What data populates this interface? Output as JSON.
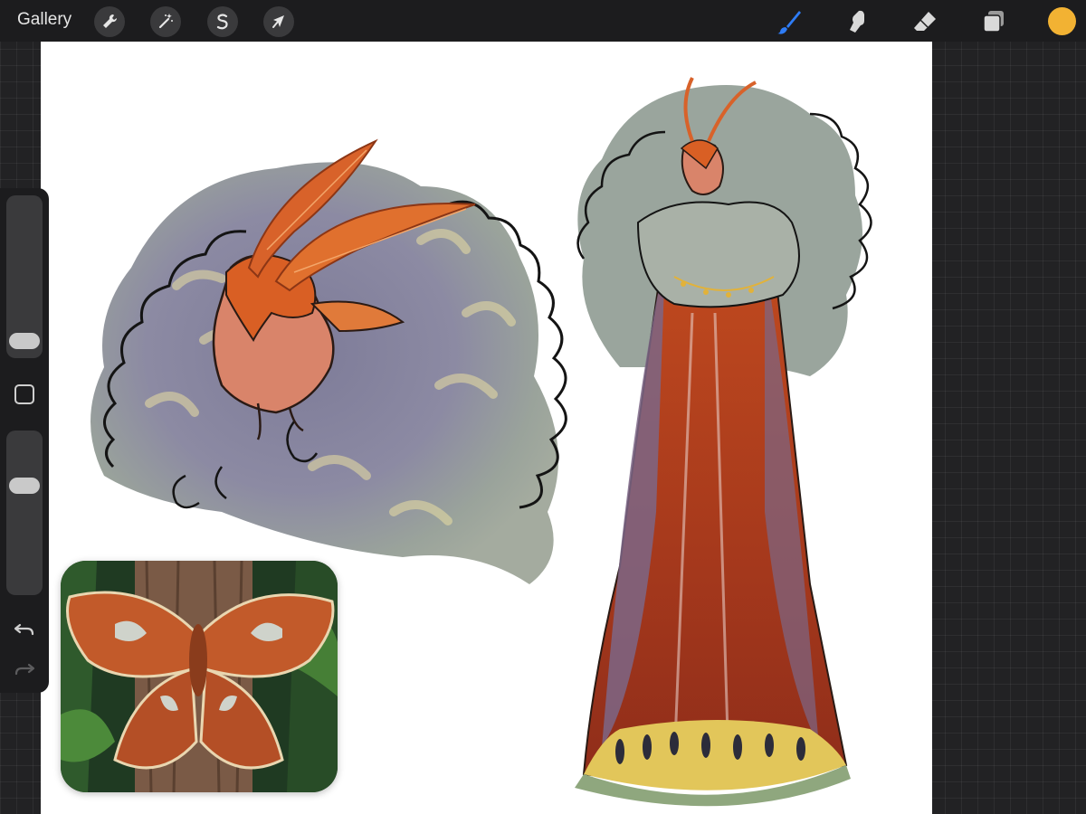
{
  "topbar": {
    "gallery_label": "Gallery",
    "left_tools": [
      {
        "name": "actions",
        "icon": "wrench-icon"
      },
      {
        "name": "adjustments",
        "icon": "magic-wand-icon"
      },
      {
        "name": "selection",
        "icon": "selection-s-icon"
      },
      {
        "name": "transform",
        "icon": "arrow-cursor-icon"
      }
    ],
    "right_tools": [
      {
        "name": "brush",
        "icon": "brush-icon",
        "active": true
      },
      {
        "name": "smudge",
        "icon": "smudge-finger-icon",
        "active": false
      },
      {
        "name": "eraser",
        "icon": "eraser-icon",
        "active": false
      },
      {
        "name": "layers",
        "icon": "layers-icon",
        "active": false
      }
    ],
    "current_color": "#f2b233",
    "active_color": "#2e7cf6",
    "inactive_icon_color": "#d9d9d9"
  },
  "sidebar": {
    "size_slider_icon": "slider-thumb",
    "modify_button_icon": "square-outline-icon",
    "opacity_slider_icon": "slider-thumb",
    "undo_icon": "undo-arrow-icon",
    "redo_icon": "redo-arrow-icon"
  },
  "canvas": {
    "background": "#ffffff",
    "artwork": [
      {
        "name": "moth-head-study",
        "icon": "portrait-sketch"
      },
      {
        "name": "moth-figure-full-body",
        "icon": "figure-sketch"
      }
    ],
    "reference_image_icon": "atlas-moth-photo"
  },
  "colors": {
    "app_bg": "#222224",
    "bar_bg": "#1c1c1e",
    "button_bg": "#3a3a3c",
    "hair_gray": "#8f9a93",
    "hair_purple": "#7f7c9a",
    "mask_orange": "#d9642a",
    "robe_red": "#b8431c",
    "robe_purple": "#7c6686",
    "hem_green": "#8fa77e",
    "hem_yellow": "#e2c65a"
  }
}
